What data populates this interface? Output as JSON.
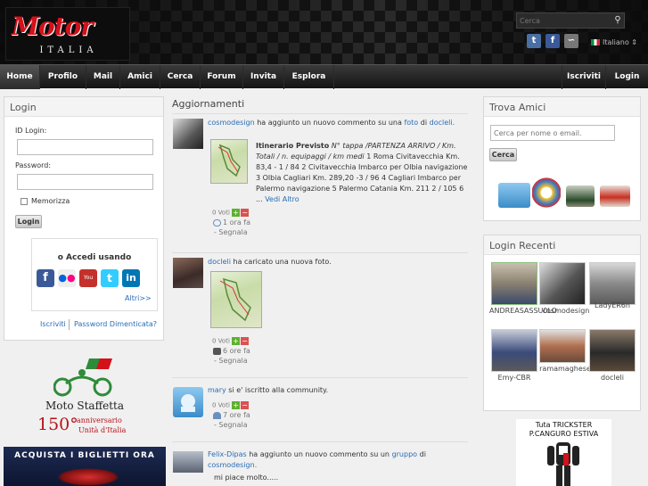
{
  "header": {
    "logo_top": "Motor",
    "logo_bottom": "ITALIA",
    "search_placeholder": "Cerca",
    "language": "Italiano"
  },
  "nav": {
    "items": [
      "Home",
      "Profilo",
      "Mail",
      "Amici",
      "Cerca",
      "Forum",
      "Invita",
      "Esplora"
    ],
    "right": [
      "Iscriviti",
      "Login"
    ]
  },
  "login": {
    "title": "Login",
    "id_label": "ID Login:",
    "password_label": "Password:",
    "remember_label": "Memorizza",
    "button": "Login",
    "oauth_title": "o Accedi usando",
    "more": "Altri>>",
    "signup": "Iscriviti",
    "forgot": "Password Dimenticata?"
  },
  "promo": {
    "staffetta_line1": "Moto Staffetta",
    "staffetta_num": "150°",
    "staffetta_line2": "anniversario",
    "staffetta_line3": "Unità d'Italia",
    "banner_text": "ACQUISTA I BIGLIETTI ORA"
  },
  "feed": {
    "title": "Aggiornamenti",
    "items": [
      {
        "user": "cosmodesign",
        "action": "ha aggiunto un nuovo commento su una",
        "link": "foto",
        "suffix": "di",
        "target": "docleli.",
        "body_title": "Itinerario Previsto",
        "body_italic": "N° tappa /PARTENZA ARRIVO / Km. Totali / n. equipaggi / km medi",
        "body_text": "1 Roma Civitavecchia Km. 83,4 - 1 / 84 2 Civitavecchia Imbarco per Olbia navigazione 3 Olbia Cagliari Km. 289,20 -3 / 96 4 Cagliari Imbarco per Palermo navigazione 5 Palermo Catania Km. 211 2 / 105 6 ...",
        "more": "Vedi Altro",
        "votes": "0 Voti",
        "time": "1 ora fa",
        "report": "- Segnala"
      },
      {
        "user": "docleli",
        "action": "ha caricato una nuova foto.",
        "votes": "0 Voti",
        "time": "6 ore fa",
        "report": "- Segnala"
      },
      {
        "user": "mary",
        "action": "si e' iscritto alla community.",
        "votes": "0 Voti",
        "time": "7 ore fa",
        "report": "- Segnala"
      },
      {
        "user": "Felix-Dipas",
        "action": "ha aggiunto un nuovo commento su un",
        "link": "gruppo",
        "suffix": "di",
        "target": "cosmodesign.",
        "comment": "mi piace molto....."
      }
    ]
  },
  "friends": {
    "title": "Trova Amici",
    "search_placeholder": "Cerca per nome o email.",
    "button": "Cerca"
  },
  "recent": {
    "title": "Login Recenti",
    "users": [
      "ANDREASASSU0LO",
      "cosmodesign",
      "LadyER6n",
      "Emy-CBR",
      "ramamaghese",
      "docleli"
    ]
  },
  "ad": {
    "line1": "Tuta TRICKSTER",
    "line2": "P.CANGURO ESTIVA"
  },
  "colors": {
    "link": "#2a6db5",
    "brand_red": "#d4111b",
    "vote_up": "#5cb030",
    "vote_down": "#d9534f"
  }
}
